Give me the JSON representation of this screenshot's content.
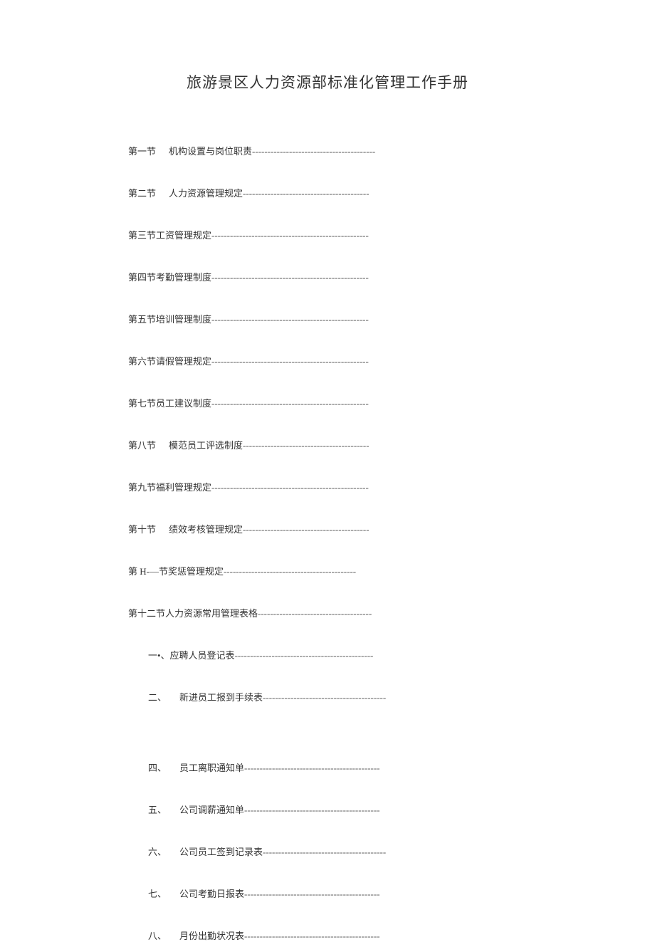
{
  "title": "旅游景区人力资源部标准化管理工作手册",
  "toc": {
    "sections": [
      {
        "label": "第一节",
        "gap": true,
        "title": "机构设置与岗位职责",
        "dashes": "----------------------------------------"
      },
      {
        "label": "第二节",
        "gap": true,
        "title": "人力资源管理规定",
        "dashes": "-----------------------------------------"
      },
      {
        "label": "第三节工资管理规定",
        "gap": false,
        "title": "",
        "dashes": " ---------------------------------------------------"
      },
      {
        "label": "第四节考勤管理制度",
        "gap": false,
        "title": "",
        "dashes": " ---------------------------------------------------"
      },
      {
        "label": "第五节培训管理制度",
        "gap": false,
        "title": "",
        "dashes": " ---------------------------------------------------"
      },
      {
        "label": "第六节请假管理规定",
        "gap": false,
        "title": "",
        "dashes": " ---------------------------------------------------"
      },
      {
        "label": "第七节员工建议制度",
        "gap": false,
        "title": "",
        "dashes": " ---------------------------------------------------"
      },
      {
        "label": "第八节",
        "gap": true,
        "title": "模范员工评选制度",
        "dashes": "-----------------------------------------"
      },
      {
        "label": "第九节福利管理规定",
        "gap": false,
        "title": "",
        "dashes": " ---------------------------------------------------"
      },
      {
        "label": "第十节",
        "gap": true,
        "title": "绩效考核管理规定",
        "dashes": "-----------------------------------------"
      },
      {
        "label": "第 H-—节奖惩管理规定",
        "gap": false,
        "title": "",
        "dashes": " -------------------------------------------"
      },
      {
        "label": "第十二节人力资源常用管理表格",
        "gap": false,
        "title": "",
        "dashes": " -------------------------------------"
      }
    ],
    "subs": [
      {
        "label": "一•、应聘人员登记表",
        "gap": false,
        "title": "",
        "dashes": " ---------------------------------------------"
      },
      {
        "label": "二、",
        "gap": true,
        "title": "新进员工报到手续表",
        "dashes": "----------------------------------------"
      },
      {
        "label": "四、",
        "gap": true,
        "title": "员工离职通知单",
        "dashes": "--------------------------------------------"
      },
      {
        "label": "五、",
        "gap": true,
        "title": "公司调薪通知单",
        "dashes": "--------------------------------------------"
      },
      {
        "label": "六、",
        "gap": true,
        "title": "公司员工签到记录表",
        "dashes": "----------------------------------------"
      },
      {
        "label": "七、",
        "gap": true,
        "title": "公司考勤日报表",
        "dashes": "--------------------------------------------"
      },
      {
        "label": "八、",
        "gap": true,
        "title": "月份出勤状况表",
        "dashes": "--------------------------------------------"
      }
    ]
  }
}
